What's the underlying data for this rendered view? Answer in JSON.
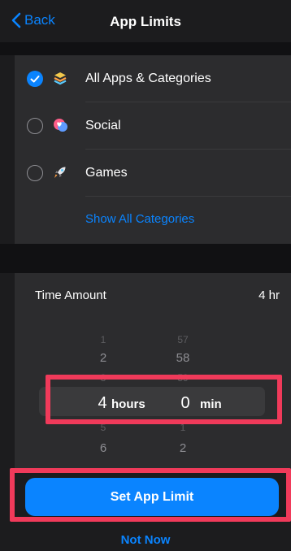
{
  "nav": {
    "back_label": "Back",
    "title": "App Limits"
  },
  "categories": [
    {
      "label": "All Apps & Categories",
      "selected": true,
      "icon": "stack-icon"
    },
    {
      "label": "Social",
      "selected": false,
      "icon": "chat-heart-icon"
    },
    {
      "label": "Games",
      "selected": false,
      "icon": "rocket-icon"
    }
  ],
  "show_all_label": "Show All Categories",
  "time_amount": {
    "label": "Time Amount",
    "value": "4 hr"
  },
  "picker": {
    "hours": {
      "above": [
        "1",
        "2",
        "3"
      ],
      "selected": "4",
      "below": [
        "5",
        "6"
      ],
      "unit": "hours"
    },
    "minutes": {
      "above": [
        "57",
        "58",
        "59"
      ],
      "selected": "0",
      "below": [
        "1",
        "2"
      ],
      "unit": "min"
    }
  },
  "actions": {
    "set_limit_label": "Set App Limit",
    "not_now_label": "Not Now"
  },
  "colors": {
    "accent": "#0a84ff",
    "background": "#1c1c1e",
    "cell": "#2c2c2e",
    "annotation": "#f03a5a"
  }
}
